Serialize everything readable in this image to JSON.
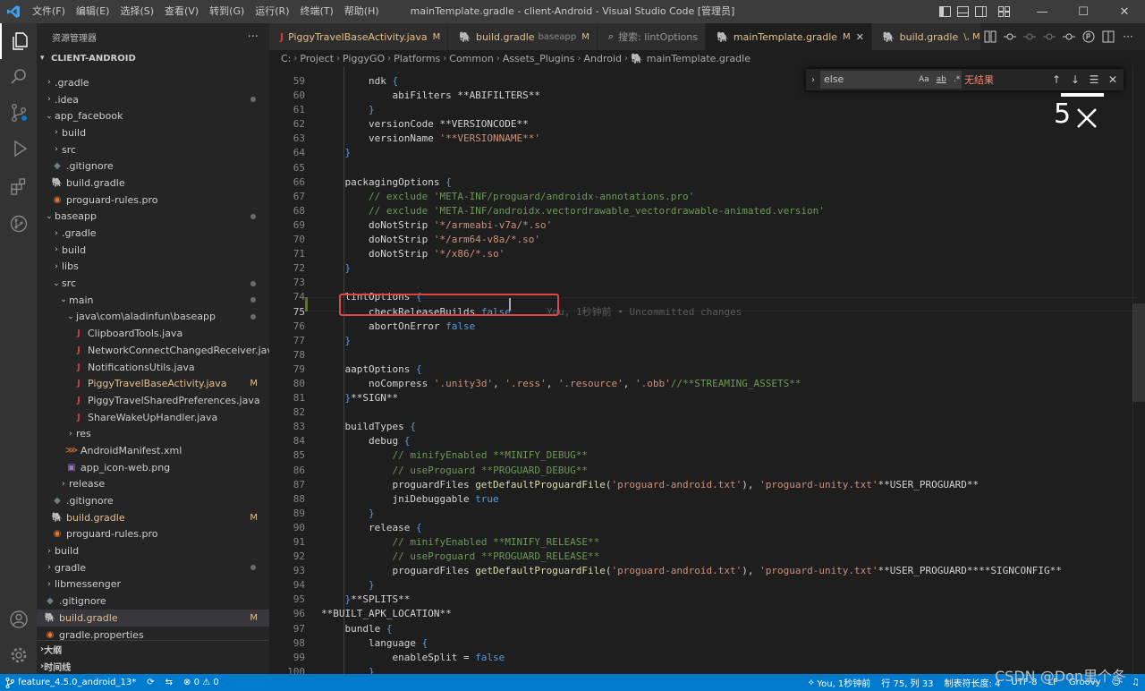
{
  "window": {
    "title": "mainTemplate.gradle - client-Android - Visual Studio Code [管理员]",
    "menus": [
      "文件(F)",
      "编辑(E)",
      "选择(S)",
      "查看(V)",
      "转到(G)",
      "运行(R)",
      "终端(T)",
      "帮助(H)"
    ],
    "controls": [
      "—",
      "☐",
      "✕"
    ]
  },
  "sidebar": {
    "title": "资源管理器",
    "more": "···",
    "project": "CLIENT-ANDROID",
    "items": [
      {
        "label": ".gradle",
        "depth": 0,
        "kind": "folder",
        "open": false,
        "state": ""
      },
      {
        "label": ".idea",
        "depth": 0,
        "kind": "folder",
        "open": false,
        "state": "dot"
      },
      {
        "label": "app_facebook",
        "depth": 0,
        "kind": "folder",
        "open": true,
        "state": ""
      },
      {
        "label": "build",
        "depth": 1,
        "kind": "folder",
        "open": false,
        "state": ""
      },
      {
        "label": "src",
        "depth": 1,
        "kind": "folder",
        "open": false,
        "state": ""
      },
      {
        "label": ".gitignore",
        "depth": 1,
        "kind": "git",
        "state": ""
      },
      {
        "label": "build.gradle",
        "depth": 1,
        "kind": "gradle",
        "state": ""
      },
      {
        "label": "proguard-rules.pro",
        "depth": 1,
        "kind": "pro",
        "state": ""
      },
      {
        "label": "baseapp",
        "depth": 0,
        "kind": "folder",
        "open": true,
        "state": "dot"
      },
      {
        "label": ".gradle",
        "depth": 1,
        "kind": "folder",
        "open": false,
        "state": ""
      },
      {
        "label": "build",
        "depth": 1,
        "kind": "folder",
        "open": false,
        "state": ""
      },
      {
        "label": "libs",
        "depth": 1,
        "kind": "folder",
        "open": false,
        "state": ""
      },
      {
        "label": "src",
        "depth": 1,
        "kind": "folder",
        "open": true,
        "state": "dot"
      },
      {
        "label": "main",
        "depth": 2,
        "kind": "folder",
        "open": true,
        "state": "dot"
      },
      {
        "label": "java\\com\\aladinfun\\baseapp",
        "depth": 3,
        "kind": "folder",
        "open": true,
        "state": "dot"
      },
      {
        "label": "ClipboardTools.java",
        "depth": 4,
        "kind": "java",
        "state": ""
      },
      {
        "label": "NetworkConnectChangedReceiver.java",
        "depth": 4,
        "kind": "java",
        "state": ""
      },
      {
        "label": "NotificationsUtils.java",
        "depth": 4,
        "kind": "java",
        "state": ""
      },
      {
        "label": "PiggyTravelBaseActivity.java",
        "depth": 4,
        "kind": "java",
        "state": "M"
      },
      {
        "label": "PiggyTravelSharedPreferences.java",
        "depth": 4,
        "kind": "java",
        "state": ""
      },
      {
        "label": "ShareWakeUpHandler.java",
        "depth": 4,
        "kind": "java",
        "state": ""
      },
      {
        "label": "res",
        "depth": 3,
        "kind": "folder",
        "open": false,
        "state": ""
      },
      {
        "label": "AndroidManifest.xml",
        "depth": 3,
        "kind": "xml",
        "state": ""
      },
      {
        "label": "app_icon-web.png",
        "depth": 3,
        "kind": "png",
        "state": ""
      },
      {
        "label": "release",
        "depth": 2,
        "kind": "folder",
        "open": false,
        "state": ""
      },
      {
        "label": ".gitignore",
        "depth": 1,
        "kind": "git",
        "state": ""
      },
      {
        "label": "build.gradle",
        "depth": 1,
        "kind": "gradle",
        "state": "M"
      },
      {
        "label": "proguard-rules.pro",
        "depth": 1,
        "kind": "pro",
        "state": ""
      },
      {
        "label": "build",
        "depth": 0,
        "kind": "folder",
        "open": false,
        "state": ""
      },
      {
        "label": "gradle",
        "depth": 0,
        "kind": "folder",
        "open": false,
        "state": "dot"
      },
      {
        "label": "libmessenger",
        "depth": 0,
        "kind": "folder",
        "open": false,
        "state": ""
      },
      {
        "label": ".gitignore",
        "depth": 0,
        "kind": "git",
        "state": ""
      },
      {
        "label": "build.gradle",
        "depth": 0,
        "kind": "gradle",
        "state": "M",
        "selected": true
      },
      {
        "label": "gradle.properties",
        "depth": 0,
        "kind": "pro",
        "state": ""
      }
    ],
    "outline": "大纲",
    "timeline": "时间线"
  },
  "tabs": [
    {
      "label": "PiggyTravelBaseActivity.java",
      "desc": "",
      "status": "M",
      "icon": "java-icon",
      "active": false
    },
    {
      "label": "build.gradle",
      "desc": "baseapp",
      "status": "M",
      "icon": "gradle-icon",
      "active": false
    },
    {
      "label": "搜索: lintOptions",
      "desc": "",
      "status": "",
      "icon": "search-icon",
      "active": false
    },
    {
      "label": "mainTemplate.gradle",
      "desc": "",
      "status": "M",
      "icon": "gradle-icon",
      "active": true
    },
    {
      "label": "build.gradle",
      "desc": "",
      "status": "\\, M",
      "icon": "gradle-icon",
      "active": false
    }
  ],
  "breadcrumb": [
    "C:",
    "Project",
    "PiggyGO",
    "Platforms",
    "Common",
    "Assets_Plugins",
    "Android",
    "mainTemplate.gradle"
  ],
  "find": {
    "value": "else",
    "options": [
      "Aa",
      "ab",
      ".*"
    ],
    "result": "无结果"
  },
  "overlay_text": "5",
  "editor": {
    "line_numbers": [
      "59",
      "60",
      "61",
      "62",
      "63",
      "64",
      "65",
      "66",
      "67",
      "68",
      "69",
      "70",
      "71",
      "72",
      "73",
      "74",
      "75",
      "76",
      "77",
      "78",
      "79",
      "80",
      "81",
      "82",
      "83",
      "84",
      "85",
      "86",
      "87",
      "88",
      "89",
      "90",
      "91",
      "92",
      "93",
      "94",
      "95",
      "96",
      "97",
      "98",
      "99",
      "100"
    ],
    "current_line": "75",
    "ghost_blame": "You, 1秒钟前 • Uncommitted changes",
    "lines": [
      [
        {
          "t": "        ndk "
        },
        {
          "t": "{",
          "c": "br"
        }
      ],
      [
        {
          "t": "            abiFilters **ABIFILTERS**"
        }
      ],
      [
        {
          "t": "        "
        },
        {
          "t": "}",
          "c": "br"
        }
      ],
      [
        {
          "t": "        versionCode **VERSIONCODE**"
        }
      ],
      [
        {
          "t": "        versionName "
        },
        {
          "t": "'**VERSIONNAME**'",
          "c": "str"
        }
      ],
      [
        {
          "t": "    "
        },
        {
          "t": "}",
          "c": "br"
        }
      ],
      [
        {
          "t": ""
        }
      ],
      [
        {
          "t": "    packagingOptions "
        },
        {
          "t": "{",
          "c": "br"
        }
      ],
      [
        {
          "t": "        "
        },
        {
          "t": "// exclude 'META-INF/proguard/androidx-annotations.pro'",
          "c": "com"
        }
      ],
      [
        {
          "t": "        "
        },
        {
          "t": "// exclude 'META-INF/androidx.vectordrawable_vectordrawable-animated.version'",
          "c": "com"
        }
      ],
      [
        {
          "t": "        doNotStrip "
        },
        {
          "t": "'*/armeabi-v7a/*.so'",
          "c": "str"
        }
      ],
      [
        {
          "t": "        doNotStrip "
        },
        {
          "t": "'*/arm64-v8a/*.so'",
          "c": "str"
        }
      ],
      [
        {
          "t": "        doNotStrip "
        },
        {
          "t": "'*/x86/*.so'",
          "c": "str"
        }
      ],
      [
        {
          "t": "    "
        },
        {
          "t": "}",
          "c": "br"
        }
      ],
      [
        {
          "t": ""
        }
      ],
      [
        {
          "t": "    lintOptions "
        },
        {
          "t": "{",
          "c": "br"
        }
      ],
      [
        {
          "t": "        checkReleaseBuilds "
        },
        {
          "t": "false",
          "c": "kw"
        }
      ],
      [
        {
          "t": "        abortOnError "
        },
        {
          "t": "false",
          "c": "kw"
        }
      ],
      [
        {
          "t": "    "
        },
        {
          "t": "}",
          "c": "br"
        }
      ],
      [
        {
          "t": ""
        }
      ],
      [
        {
          "t": "    aaptOptions "
        },
        {
          "t": "{",
          "c": "br"
        }
      ],
      [
        {
          "t": "        noCompress "
        },
        {
          "t": "'.unity3d'",
          "c": "str"
        },
        {
          "t": ", "
        },
        {
          "t": "'.ress'",
          "c": "str"
        },
        {
          "t": ", "
        },
        {
          "t": "'.resource'",
          "c": "str"
        },
        {
          "t": ", "
        },
        {
          "t": "'.obb'",
          "c": "str"
        },
        {
          "t": "//**STREAMING_ASSETS**",
          "c": "com"
        }
      ],
      [
        {
          "t": "    "
        },
        {
          "t": "}",
          "c": "br"
        },
        {
          "t": "**SIGN**"
        }
      ],
      [
        {
          "t": ""
        }
      ],
      [
        {
          "t": "    buildTypes "
        },
        {
          "t": "{",
          "c": "br"
        }
      ],
      [
        {
          "t": "        debug "
        },
        {
          "t": "{",
          "c": "br"
        }
      ],
      [
        {
          "t": "            "
        },
        {
          "t": "// minifyEnabled **MINIFY_DEBUG**",
          "c": "com"
        }
      ],
      [
        {
          "t": "            "
        },
        {
          "t": "// useProguard **PROGUARD_DEBUG**",
          "c": "com"
        }
      ],
      [
        {
          "t": "            proguardFiles "
        },
        {
          "t": "getDefaultProguardFile",
          "c": "fn"
        },
        {
          "t": "("
        },
        {
          "t": "'proguard-android.txt'",
          "c": "str"
        },
        {
          "t": "), "
        },
        {
          "t": "'proguard-unity.txt'",
          "c": "str"
        },
        {
          "t": "**USER_PROGUARD**"
        }
      ],
      [
        {
          "t": "            jniDebuggable "
        },
        {
          "t": "true",
          "c": "kw"
        }
      ],
      [
        {
          "t": "        "
        },
        {
          "t": "}",
          "c": "br"
        }
      ],
      [
        {
          "t": "        release "
        },
        {
          "t": "{",
          "c": "br"
        }
      ],
      [
        {
          "t": "            "
        },
        {
          "t": "// minifyEnabled **MINIFY_RELEASE**",
          "c": "com"
        }
      ],
      [
        {
          "t": "            "
        },
        {
          "t": "// useProguard **PROGUARD_RELEASE**",
          "c": "com"
        }
      ],
      [
        {
          "t": "            proguardFiles "
        },
        {
          "t": "getDefaultProguardFile",
          "c": "fn"
        },
        {
          "t": "("
        },
        {
          "t": "'proguard-android.txt'",
          "c": "str"
        },
        {
          "t": "), "
        },
        {
          "t": "'proguard-unity.txt'",
          "c": "str"
        },
        {
          "t": "**USER_PROGUARD****SIGNCONFIG**"
        }
      ],
      [
        {
          "t": "        "
        },
        {
          "t": "}",
          "c": "br"
        }
      ],
      [
        {
          "t": "    "
        },
        {
          "t": "}",
          "c": "br"
        },
        {
          "t": "**SPLITS**"
        }
      ],
      [
        {
          "t": "**BUILT_APK_LOCATION**"
        }
      ],
      [
        {
          "t": "    bundle "
        },
        {
          "t": "{",
          "c": "br"
        }
      ],
      [
        {
          "t": "        language "
        },
        {
          "t": "{",
          "c": "br"
        }
      ],
      [
        {
          "t": "            enableSplit = "
        },
        {
          "t": "false",
          "c": "kw"
        }
      ],
      [
        {
          "t": "        "
        },
        {
          "t": "}",
          "c": "br"
        }
      ]
    ]
  },
  "status": {
    "branch": "feature_4.5.0_android_13*",
    "problems": "0",
    "warnings": "0",
    "blame": "You, 1秒钟前",
    "position": "行 75, 列 33",
    "indent": "制表符长度: 4",
    "encoding": "UTF-8",
    "eol": "LF",
    "language": "Groovy"
  },
  "watermark": "CSDN @Don里个冬",
  "colors": {
    "accent": "#007acc",
    "modified": "#e2c08d",
    "highlight_box": "#e04545"
  }
}
